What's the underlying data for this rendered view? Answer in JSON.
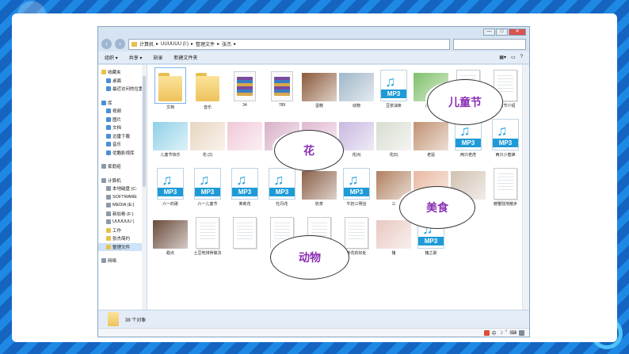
{
  "window": {
    "controls": [
      "—",
      "□",
      "✕"
    ],
    "breadcrumb": [
      "计算机",
      "UUUUUU (I:)",
      "整理文件",
      "张杰"
    ]
  },
  "toolbar": {
    "organize": "组织 ▾",
    "share": "共享 ▾",
    "burn": "刻录",
    "new_folder": "新建文件夹"
  },
  "sidebar": {
    "items": [
      {
        "label": "收藏夹",
        "icon": "star-icon",
        "sub": false
      },
      {
        "label": "桌面",
        "icon": "desktop-icon",
        "sub": true
      },
      {
        "label": "最近访问的位置",
        "icon": "recent-icon",
        "sub": true
      },
      {
        "gap": true
      },
      {
        "label": "库",
        "icon": "library-icon",
        "sub": false
      },
      {
        "label": "视频",
        "icon": "video-icon",
        "sub": true
      },
      {
        "label": "图片",
        "icon": "pictures-icon",
        "sub": true
      },
      {
        "label": "文档",
        "icon": "documents-icon",
        "sub": true
      },
      {
        "label": "迅雷下载",
        "icon": "download-icon",
        "sub": true
      },
      {
        "label": "音乐",
        "icon": "music-icon",
        "sub": true
      },
      {
        "label": "优酷影视库",
        "icon": "video-library-icon",
        "sub": true
      },
      {
        "gap": true
      },
      {
        "label": "家庭组",
        "icon": "homegroup-icon",
        "sub": false
      },
      {
        "gap": true
      },
      {
        "label": "计算机",
        "icon": "computer-icon",
        "sub": false
      },
      {
        "label": "本地磁盘 (C:",
        "icon": "drive-icon",
        "sub": true
      },
      {
        "label": "SOFTWARE",
        "icon": "drive-icon",
        "sub": true
      },
      {
        "label": "MEDIA (E:)",
        "icon": "drive-icon",
        "sub": true
      },
      {
        "label": "新加卷 (F:)",
        "icon": "drive-icon",
        "sub": true
      },
      {
        "label": "UUUUUU (",
        "icon": "drive-icon",
        "sub": true
      },
      {
        "label": "工作",
        "icon": "folder-icon",
        "sub": true
      },
      {
        "label": "张杰简约",
        "icon": "folder-icon",
        "sub": true
      },
      {
        "label": "整理文件",
        "icon": "folder-icon",
        "sub": true,
        "selected": true
      },
      {
        "gap": true
      },
      {
        "label": "网络",
        "icon": "network-icon",
        "sub": false
      }
    ]
  },
  "files": [
    {
      "name": "文档",
      "kind": "folder",
      "selected": true
    },
    {
      "name": "音乐",
      "kind": "folder"
    },
    {
      "name": "34",
      "kind": "rar"
    },
    {
      "name": "789",
      "kind": "rar"
    },
    {
      "name": "蛋糕",
      "kind": "image",
      "color": "#8a5a3a"
    },
    {
      "name": "动物",
      "kind": "image",
      "color": "#9fb6c8"
    },
    {
      "name": "豆浆油条",
      "kind": "mp3"
    },
    {
      "name": "儿童节",
      "kind": "image",
      "color": "#7fbf6a"
    },
    {
      "name": "",
      "kind": "doc"
    },
    {
      "name": "儿童节介绍",
      "kind": "doc"
    },
    {
      "name": "儿童节快乐",
      "kind": "image",
      "color": "#8fd0e8"
    },
    {
      "name": "花 (2)",
      "kind": "image",
      "color": "#e8d5c0"
    },
    {
      "name": "",
      "kind": "image",
      "color": "#f0c8d8"
    },
    {
      "name": "花 (6)",
      "kind": "image",
      "color": "#d8b0c8"
    },
    {
      "name": "花(1)",
      "kind": "image",
      "color": "#e0b8d0"
    },
    {
      "name": "花(4)",
      "kind": "image",
      "color": "#c8b8e0"
    },
    {
      "name": "花(5)",
      "kind": "image",
      "color": "#d8dcd0"
    },
    {
      "name": "老鼠",
      "kind": "image",
      "color": "#c09070"
    },
    {
      "name": "两只老虎",
      "kind": "mp3"
    },
    {
      "name": "两只小蜜蜂",
      "kind": "mp3"
    },
    {
      "name": "六一的歌",
      "kind": "mp3"
    },
    {
      "name": "六一儿童节",
      "kind": "mp3"
    },
    {
      "name": "茉莉花",
      "kind": "mp3"
    },
    {
      "name": "牡丹花",
      "kind": "mp3"
    },
    {
      "name": "奶茶",
      "kind": "image",
      "color": "#8a6048"
    },
    {
      "name": "牛奶三明治",
      "kind": "mp3"
    },
    {
      "name": "三",
      "kind": "image",
      "color": "#b08060"
    },
    {
      "name": "",
      "kind": "image",
      "color": "#e8b8a0"
    },
    {
      "name": "蘑菇",
      "kind": "image",
      "color": "#d0c0b0"
    },
    {
      "name": "螃蟹陆地散步",
      "kind": "doc"
    },
    {
      "name": "甜点",
      "kind": "image",
      "color": "#6a4a3a"
    },
    {
      "name": "土豆地排骨做法",
      "kind": "doc"
    },
    {
      "name": "",
      "kind": "doc"
    },
    {
      "name": "",
      "kind": "doc"
    },
    {
      "name": "养动物的方法",
      "kind": "doc"
    },
    {
      "name": "养花的好处",
      "kind": "doc"
    },
    {
      "name": "猪",
      "kind": "image",
      "color": "#e8c8c0"
    },
    {
      "name": "猪之歌",
      "kind": "mp3"
    }
  ],
  "callouts": {
    "children_day": "儿童节",
    "flower": "花",
    "food": "美食",
    "animal": "动物"
  },
  "status": {
    "count": "38 个对象"
  },
  "tray": {
    "ime": "中",
    "moon": "☽",
    "dot": "°",
    "kb": "⌨"
  }
}
